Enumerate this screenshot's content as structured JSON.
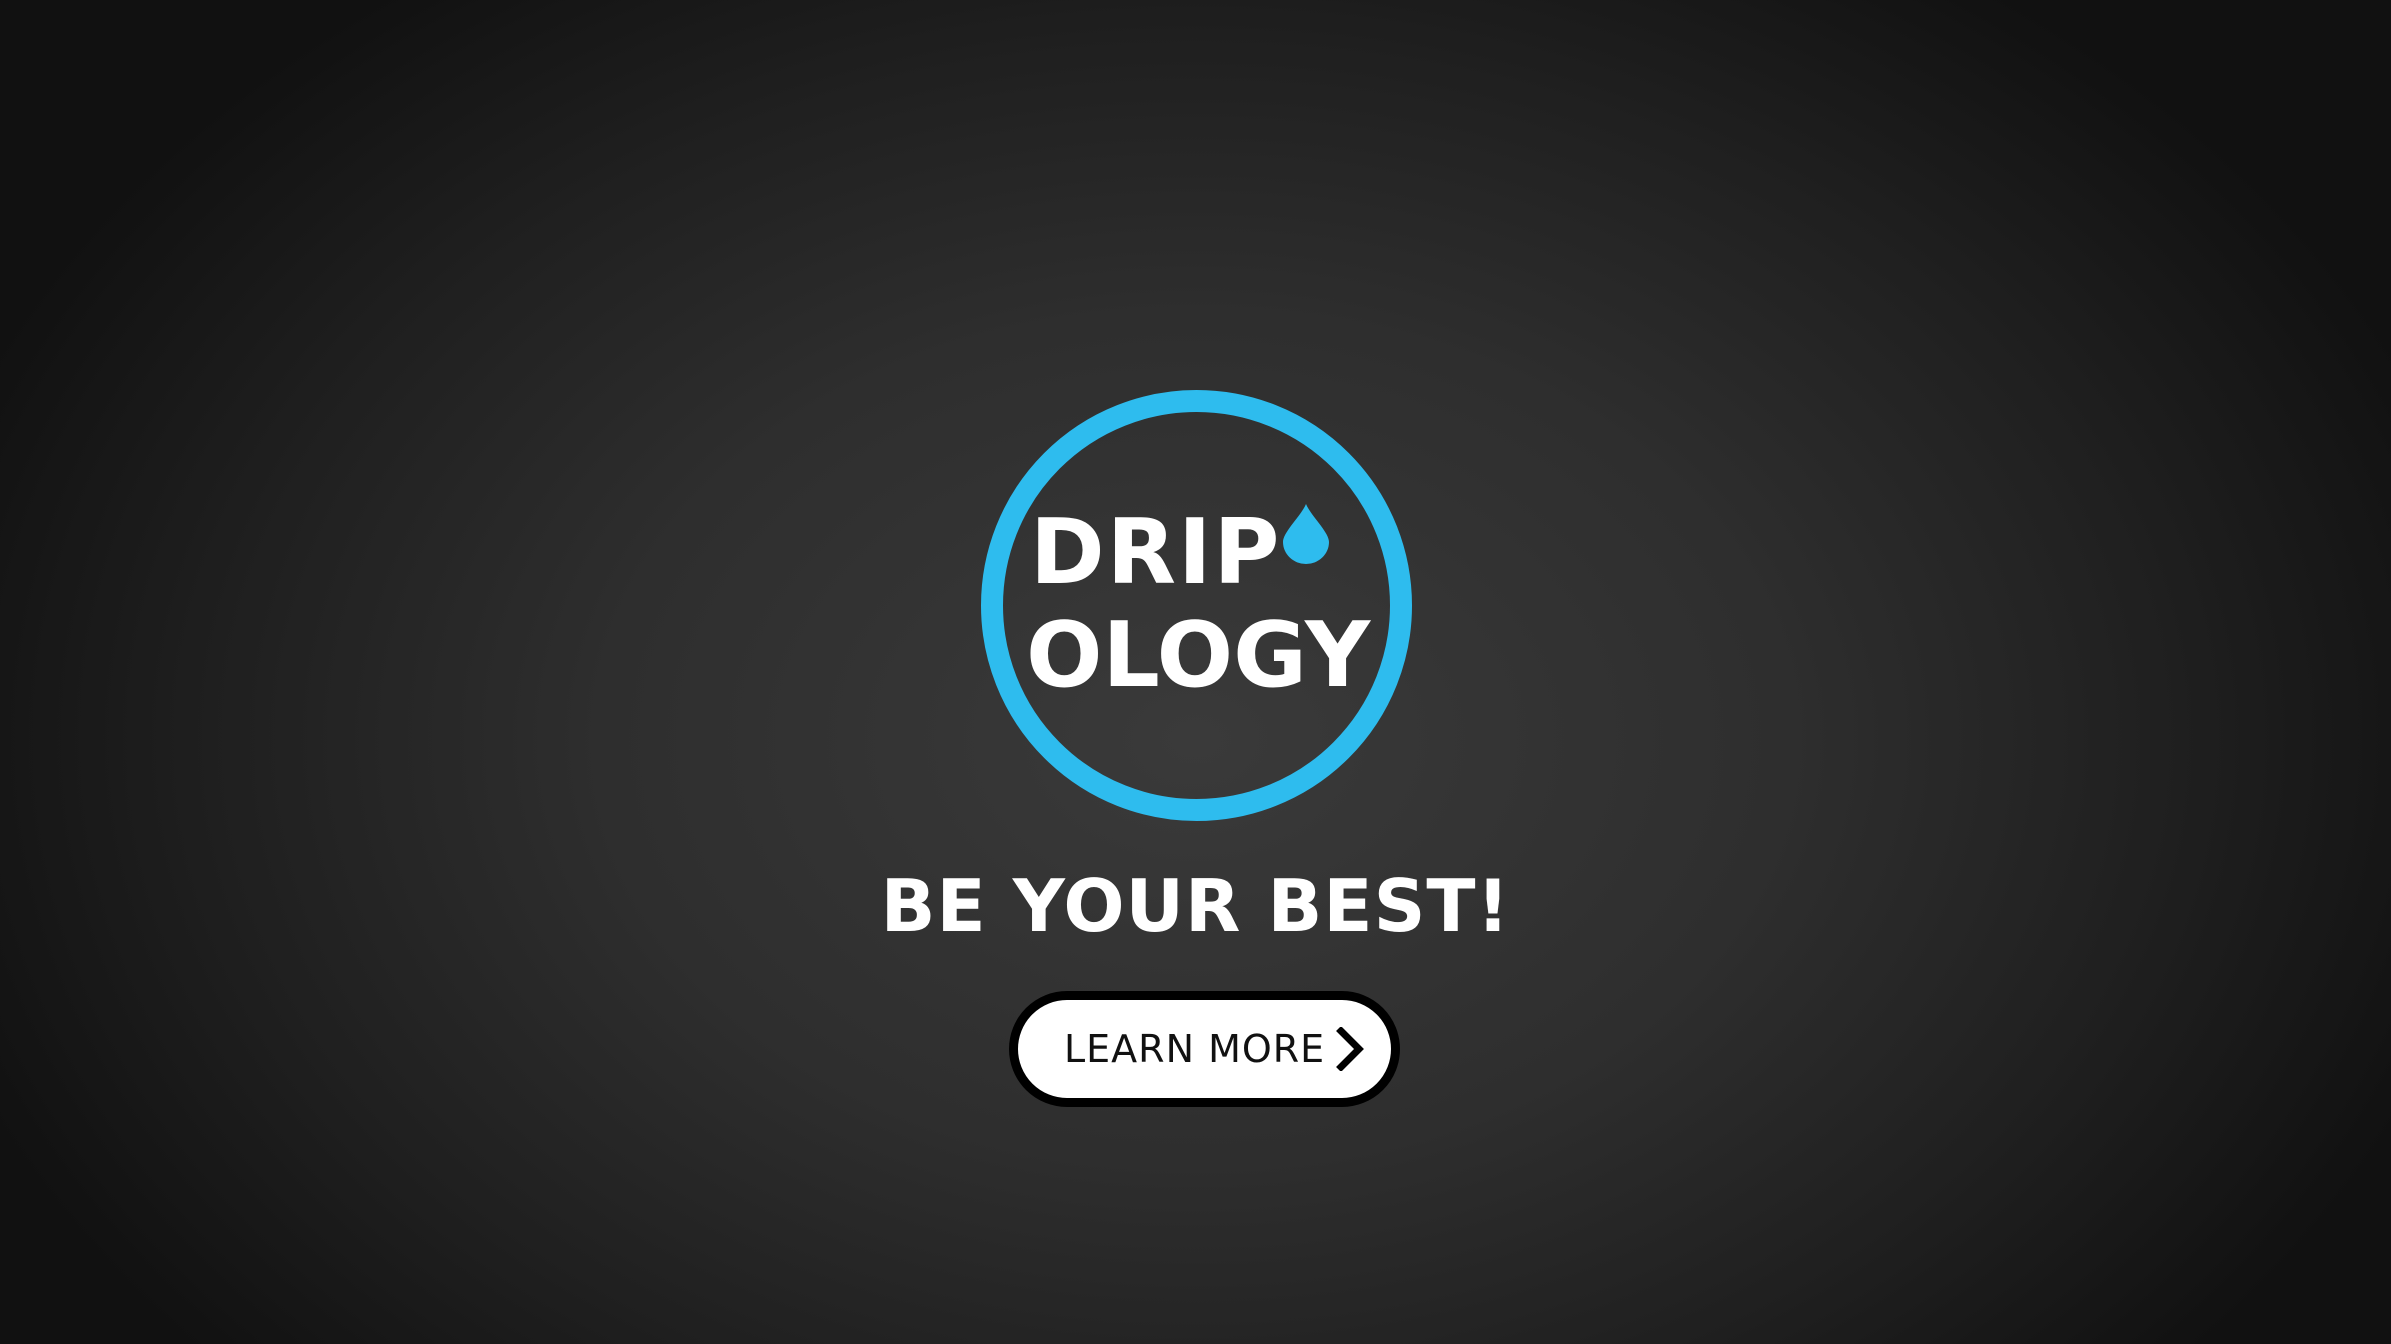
{
  "logo": {
    "line1": "DRIP",
    "line2": "OLOGY",
    "accent_color": "#2ebcee",
    "icon": "water-drop-icon"
  },
  "tagline": "BE YOUR BEST!",
  "cta": {
    "label": "LEARN MORE",
    "icon": "chevron-right-icon"
  }
}
